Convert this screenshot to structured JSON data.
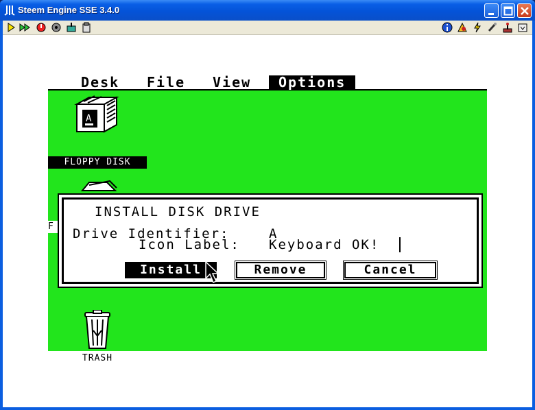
{
  "window": {
    "title": "Steem Engine SSE 3.4.0",
    "colors": {
      "titlebar": "#0453d8",
      "desktop": "#22e51c"
    }
  },
  "toolbar": {
    "left_buttons": [
      "play-icon",
      "fast-forward-icon",
      "reset-icon",
      "disk-manager-icon",
      "joystick-config-icon",
      "paste-icon"
    ],
    "right_buttons": [
      "info-icon",
      "patches-icon",
      "shortcuts-icon",
      "options-icon",
      "joystick-icon",
      "more-icon"
    ]
  },
  "atari": {
    "menus": [
      "Desk",
      "File",
      "View",
      "Options"
    ],
    "active_menu": "Options",
    "icons": {
      "floppy_label": "FLOPPY DISK",
      "floppy_letter": "A",
      "trash_label": "TRASH",
      "hidden_label_initial": "F"
    },
    "dialog": {
      "title": "INSTALL DISK DRIVE",
      "drive_identifier_label": "Drive Identifier:",
      "drive_identifier_value": "A",
      "icon_label_label": "Icon Label:",
      "icon_label_value": "Keyboard OK!",
      "buttons": {
        "install": "Install",
        "remove": "Remove",
        "cancel": "Cancel"
      }
    }
  }
}
